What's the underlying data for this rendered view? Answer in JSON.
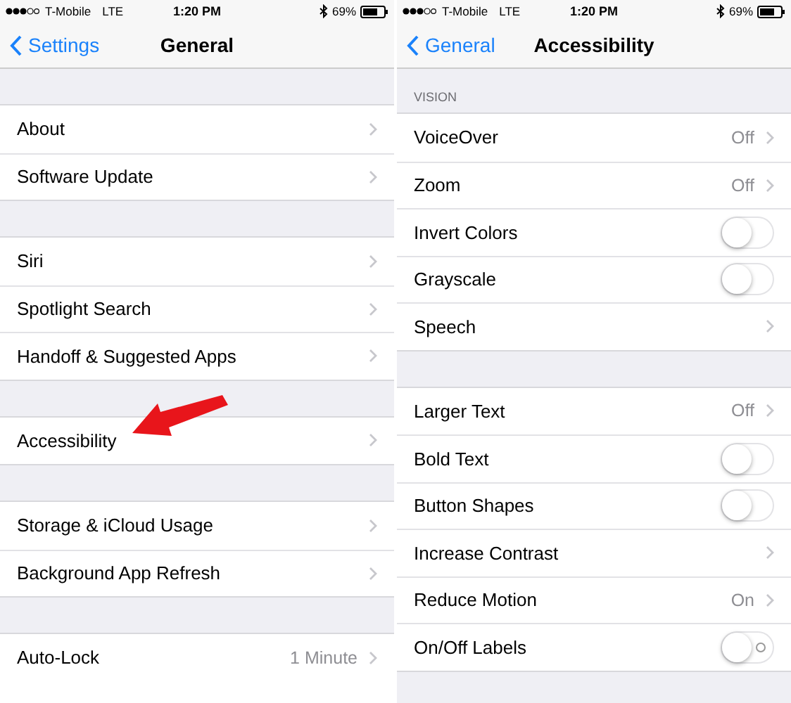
{
  "screens": [
    {
      "status_bar": {
        "carrier": "T-Mobile",
        "network": "LTE",
        "time": "1:20 PM",
        "battery": "69%"
      },
      "nav": {
        "back": "Settings",
        "title": "General"
      },
      "sections": [
        {
          "rows": [
            {
              "kind": "link",
              "label": "About"
            },
            {
              "kind": "link",
              "label": "Software Update"
            }
          ]
        },
        {
          "rows": [
            {
              "kind": "link",
              "label": "Siri"
            },
            {
              "kind": "link",
              "label": "Spotlight Search"
            },
            {
              "kind": "link",
              "label": "Handoff & Suggested Apps"
            }
          ]
        },
        {
          "rows": [
            {
              "kind": "link",
              "label": "Accessibility"
            }
          ]
        },
        {
          "rows": [
            {
              "kind": "link",
              "label": "Storage & iCloud Usage"
            },
            {
              "kind": "link",
              "label": "Background App Refresh"
            }
          ]
        },
        {
          "rows": [
            {
              "kind": "link",
              "label": "Auto-Lock",
              "value": "1 Minute"
            }
          ]
        }
      ]
    },
    {
      "status_bar": {
        "carrier": "T-Mobile",
        "network": "LTE",
        "time": "1:20 PM",
        "battery": "69%"
      },
      "nav": {
        "back": "General",
        "title": "Accessibility"
      },
      "sections": [
        {
          "header": "VISION",
          "rows": [
            {
              "kind": "link",
              "label": "VoiceOver",
              "value": "Off"
            },
            {
              "kind": "link",
              "label": "Zoom",
              "value": "Off"
            },
            {
              "kind": "toggle",
              "label": "Invert Colors",
              "on": false
            },
            {
              "kind": "toggle",
              "label": "Grayscale",
              "on": false
            },
            {
              "kind": "link",
              "label": "Speech"
            }
          ]
        },
        {
          "rows": [
            {
              "kind": "link",
              "label": "Larger Text",
              "value": "Off"
            },
            {
              "kind": "toggle",
              "label": "Bold Text",
              "on": false
            },
            {
              "kind": "toggle",
              "label": "Button Shapes",
              "on": false
            },
            {
              "kind": "link",
              "label": "Increase Contrast"
            },
            {
              "kind": "link",
              "label": "Reduce Motion",
              "value": "On"
            },
            {
              "kind": "labeled-toggle",
              "label": "On/Off Labels",
              "on": false
            }
          ]
        }
      ]
    }
  ]
}
